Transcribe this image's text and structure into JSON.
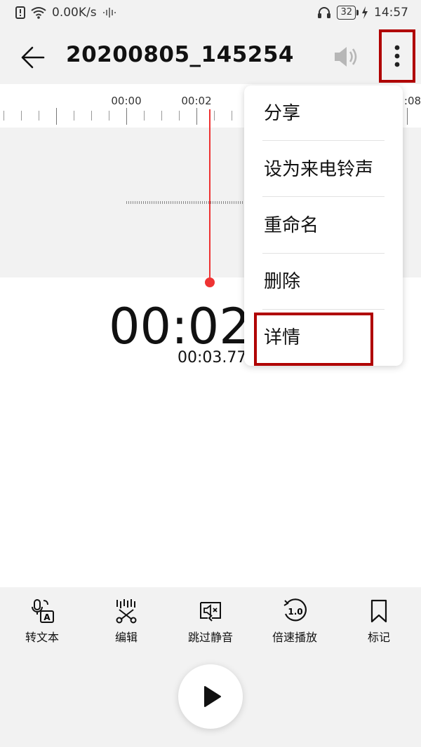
{
  "status_bar": {
    "net_speed": "0.00K/s",
    "battery": "32",
    "time": "14:57"
  },
  "header": {
    "title": "20200805_145254"
  },
  "timeline": {
    "labels": [
      "00:00",
      "00:02",
      ":08"
    ]
  },
  "playback": {
    "current_time": "00:02",
    "total_time": "00:03.77"
  },
  "menu": {
    "items": [
      "分享",
      "设为来电铃声",
      "重命名",
      "删除",
      "详情"
    ]
  },
  "toolbar": {
    "items": [
      {
        "label": "转文本",
        "icon": "speech-to-text-icon"
      },
      {
        "label": "编辑",
        "icon": "edit-cut-icon"
      },
      {
        "label": "跳过静音",
        "icon": "skip-silence-icon"
      },
      {
        "label": "倍速播放",
        "icon": "playback-speed-icon",
        "icon_text": "1.0"
      },
      {
        "label": "标记",
        "icon": "bookmark-icon"
      }
    ]
  },
  "colors": {
    "accent_red": "#ee3333",
    "highlight_border": "#b00000"
  }
}
